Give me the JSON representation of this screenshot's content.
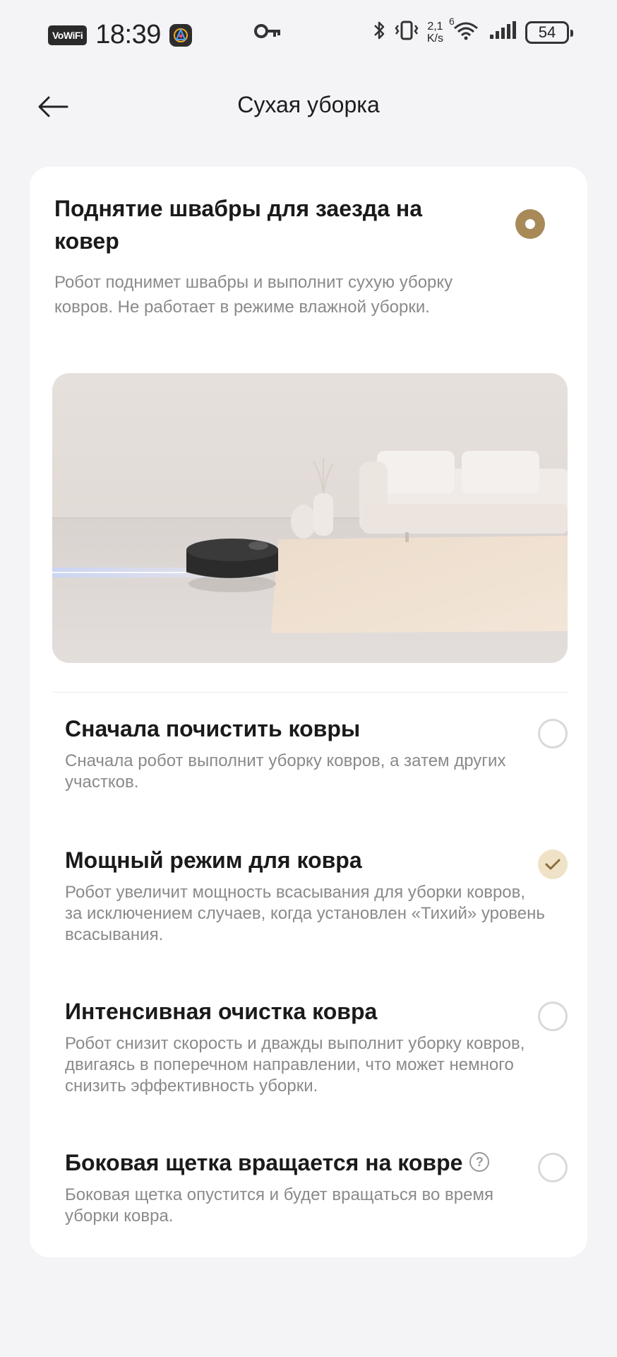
{
  "status_bar": {
    "vowifi": "VoWiFi",
    "time": "18:39",
    "net_speed_value": "2,1",
    "net_speed_unit": "K/s",
    "wifi_label": "6",
    "battery": "54"
  },
  "header": {
    "title": "Сухая уборка"
  },
  "main_option": {
    "title": "Поднятие швабры для заезда на ковер",
    "description": "Робот поднимет швабры и выполнит сухую уборку ковров. Не работает в режиме влажной уборки.",
    "selected": true
  },
  "options": [
    {
      "title": "Сначала почистить ковры",
      "description": "Сначала робот выполнит уборку ковров, а затем других участков.",
      "checked": false
    },
    {
      "title": "Мощный режим для ковра",
      "description": "Робот увеличит мощность всасывания для уборки ковров, за исключением случаев, когда установлен «Тихий» уровень всасывания.",
      "checked": true
    },
    {
      "title": "Интенсивная очистка ковра",
      "description": "Робот снизит скорость и дважды выполнит уборку ковров, двигаясь в поперечном направлении, что может немного снизить эффективность уборки.",
      "checked": false
    },
    {
      "title": "Боковая щетка вращается на ковре",
      "description": "Боковая щетка опустится и будет вращаться во время уборки ковра.",
      "checked": false
    }
  ],
  "colors": {
    "accent": "#a88a58",
    "accent_light": "#efe2c6",
    "background": "#f4f3f6",
    "card": "#ffffff"
  }
}
